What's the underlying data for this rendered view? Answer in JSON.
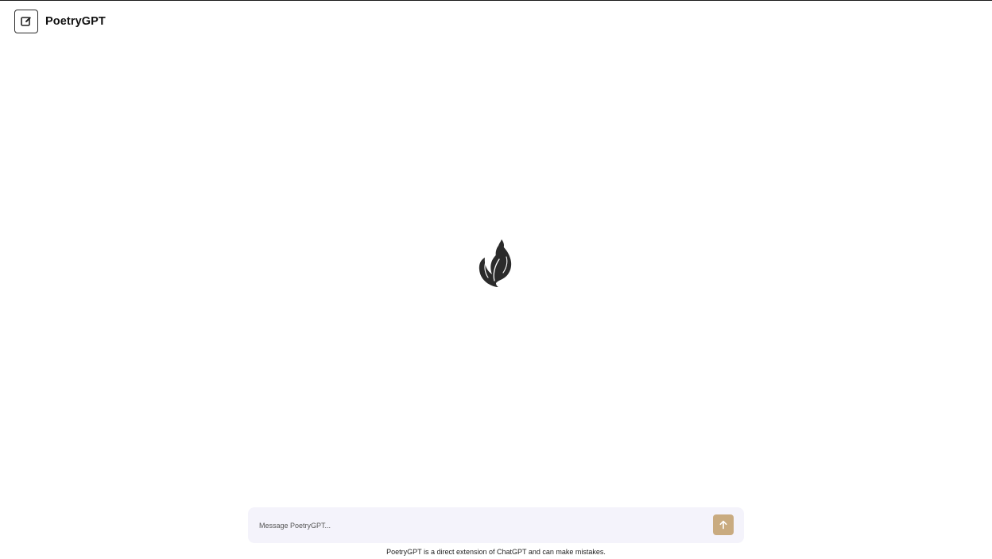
{
  "header": {
    "title": "PoetryGPT",
    "new_chat_icon": "edit-square-icon"
  },
  "center": {
    "logo_icon": "leaf-icon"
  },
  "composer": {
    "placeholder": "Message PoetryGPT...",
    "value": "",
    "send_icon": "arrow-up-icon"
  },
  "footer": {
    "disclaimer": "PoetryGPT is a direct extension of ChatGPT and can make mistakes."
  },
  "colors": {
    "accent": "#c9ab80",
    "composer_bg": "#f4f3fb",
    "logo": "#2b2b2b"
  }
}
